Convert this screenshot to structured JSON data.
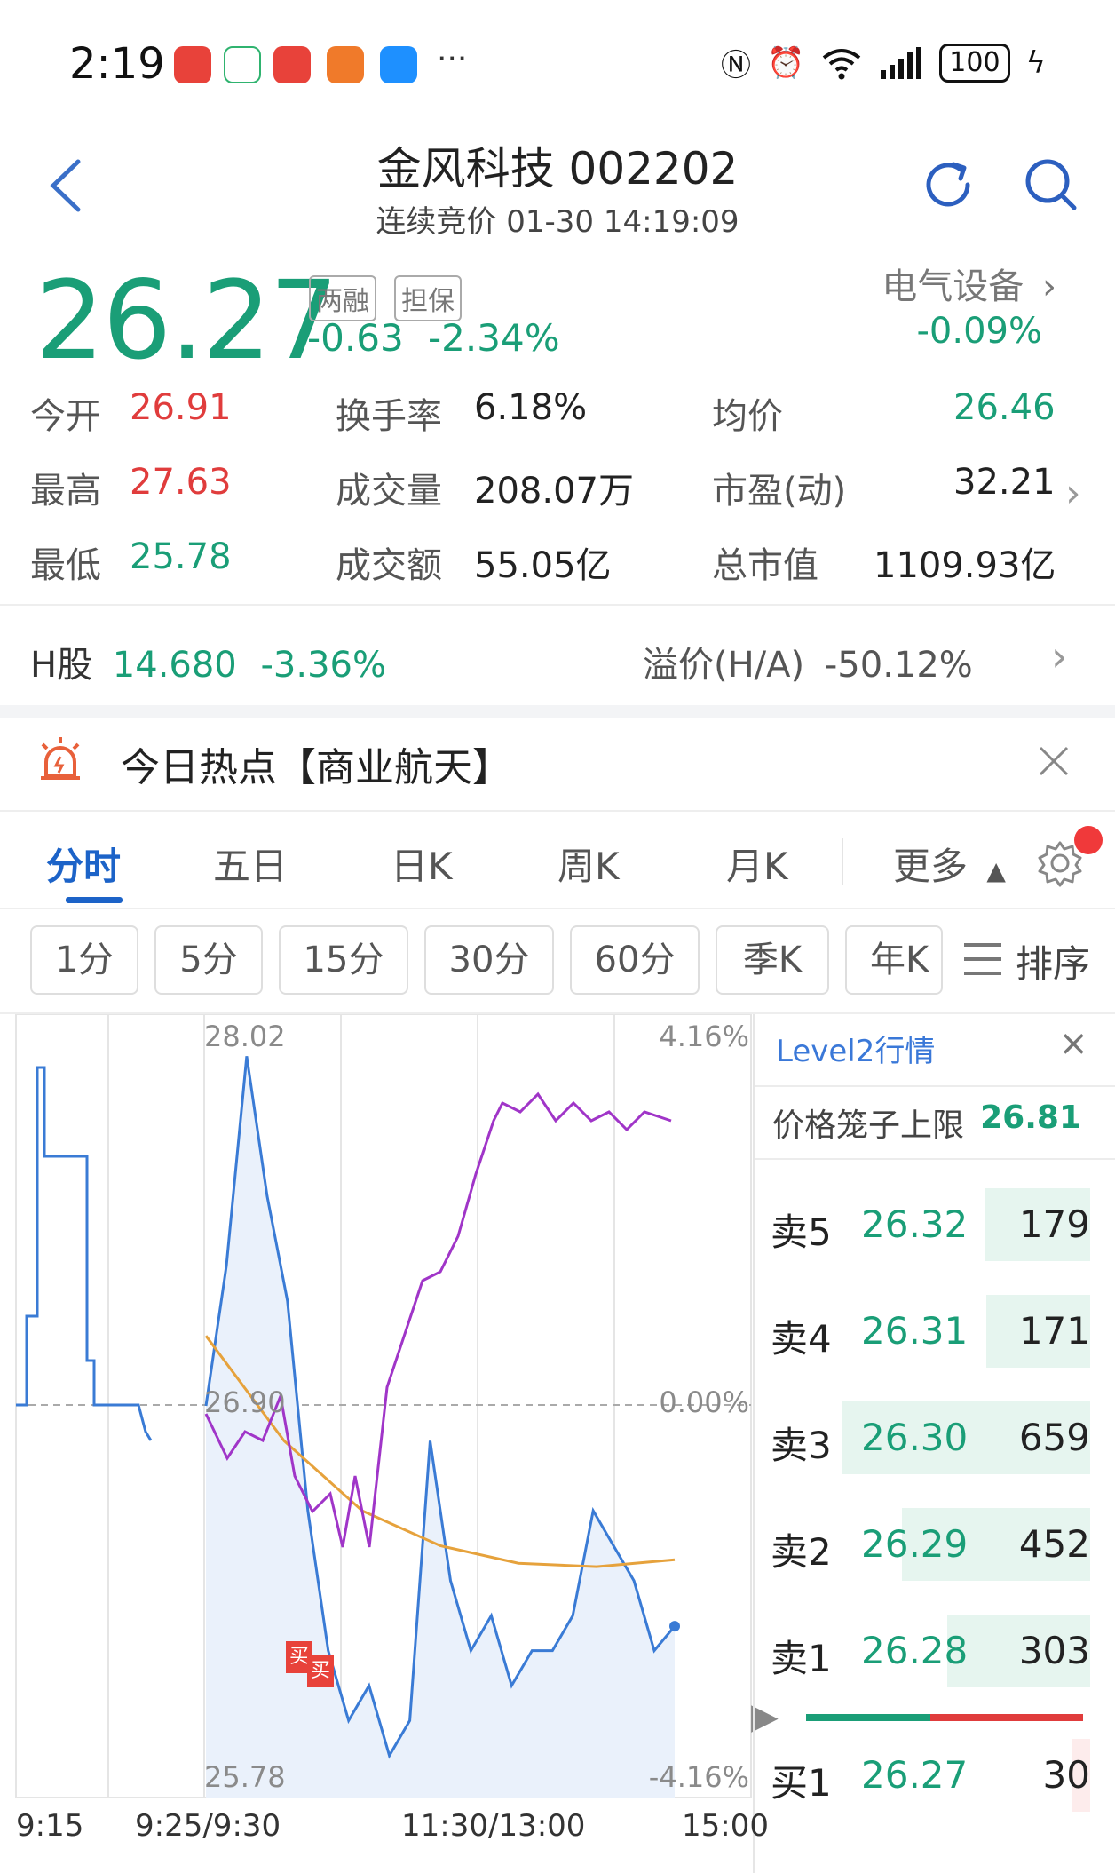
{
  "status_bar": {
    "time": "2:19",
    "more_icons": "···",
    "battery": "100",
    "app_colors": [
      "#e8423a",
      "#2fb36f",
      "#e8423a",
      "#f07a2a",
      "#1e90ff"
    ]
  },
  "header": {
    "title": "金风科技 002202",
    "subtitle": "连续竞价 01-30 14:19:09"
  },
  "quote": {
    "price": "26.27",
    "tag_margin": "两融",
    "tag_guarantee": "担保",
    "change": "-0.63",
    "change_pct": "-2.34%",
    "sector_name": "电气设备",
    "sector_change": "-0.09%"
  },
  "stats": {
    "open_label": "今开",
    "open_value": "26.91",
    "high_label": "最高",
    "high_value": "27.63",
    "low_label": "最低",
    "low_value": "25.78",
    "turnover_label": "换手率",
    "turnover_value": "6.18%",
    "volume_label": "成交量",
    "volume_value": "208.07万",
    "amount_label": "成交额",
    "amount_value": "55.05亿",
    "avg_label": "均价",
    "avg_value": "26.46",
    "pe_label": "市盈(动)",
    "pe_value": "32.21",
    "mcap_label": "总市值",
    "mcap_value": "1109.93亿"
  },
  "hshare": {
    "label": "H股",
    "price": "14.680",
    "change_pct": "-3.36%",
    "premium_label": "溢价(H/A)",
    "premium_value": "-50.12%"
  },
  "hot": {
    "text": "今日热点【商业航天】"
  },
  "tabs": {
    "items": [
      "分时",
      "五日",
      "日K",
      "周K",
      "月K",
      "更多"
    ],
    "active": "分时"
  },
  "periods": {
    "items": [
      "1分",
      "5分",
      "15分",
      "30分",
      "60分",
      "季K",
      "年K"
    ],
    "sort_label": "排序"
  },
  "chart": {
    "top_price": "28.02",
    "bottom_price": "25.78",
    "mid_price": "26.90",
    "top_pct": "4.16%",
    "mid_pct": "0.00%",
    "bottom_pct": "-4.16%",
    "time_labels": [
      "9:15",
      "9:25/9:30",
      "11:30/13:00",
      "15:00"
    ],
    "buy_marker": "买",
    "colors": {
      "price": "#3a7bd5",
      "avg": "#e6a23c",
      "purple": "#a035c8"
    }
  },
  "chart_data": {
    "type": "line",
    "ylim": [
      25.78,
      28.02
    ],
    "series": [
      {
        "values": [
          26.9,
          27.3,
          27.9,
          27.5,
          27.2,
          26.6,
          26.2,
          26.0,
          26.1,
          25.9,
          26.0,
          26.8,
          26.4,
          26.2,
          26.3,
          26.1,
          26.2,
          26.2,
          26.3,
          26.6,
          26.5,
          26.4,
          26.2,
          26.27
        ]
      },
      {
        "values": [
          27.1,
          26.8,
          26.6,
          26.5,
          26.45,
          26.44,
          26.46
        ]
      }
    ]
  },
  "level2": {
    "title": "Level2行情",
    "close": "×",
    "cage_label": "价格笼子上限",
    "cage_value": "26.81",
    "asks": [
      {
        "name": "卖5",
        "price": "26.32",
        "volume": "179",
        "ratio": 0.27
      },
      {
        "name": "卖4",
        "price": "26.31",
        "volume": "171",
        "ratio": 0.26
      },
      {
        "name": "卖3",
        "price": "26.30",
        "volume": "659",
        "ratio": 1.0
      },
      {
        "name": "卖2",
        "price": "26.29",
        "volume": "452",
        "ratio": 0.69
      },
      {
        "name": "卖1",
        "price": "26.28",
        "volume": "303",
        "ratio": 0.46
      }
    ],
    "bids": [
      {
        "name": "买1",
        "price": "26.27",
        "volume": "30",
        "ratio": 0.05
      }
    ]
  }
}
